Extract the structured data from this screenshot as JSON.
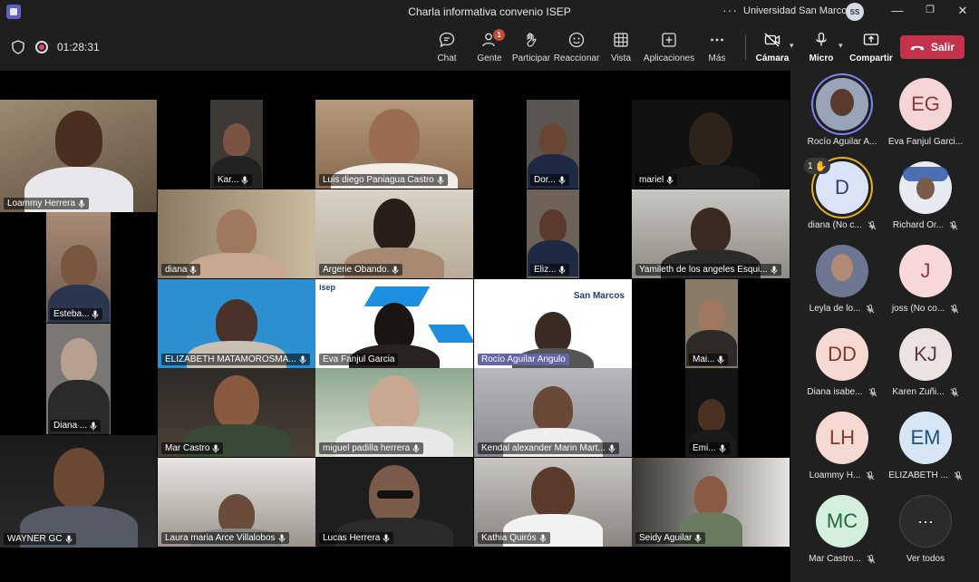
{
  "window": {
    "title": "Charla informativa convenio ISEP",
    "org": "Universidad San Marcos",
    "user_initials": "SS",
    "menu_glyph": "···",
    "min_glyph": "—",
    "max_glyph": "❐",
    "close_glyph": "✕"
  },
  "meeting": {
    "timer": "01:28:31",
    "toolbar": {
      "chat": "Chat",
      "people": "Gente",
      "people_badge": "1",
      "raise": "Participar",
      "react": "Reaccionar",
      "view": "Vista",
      "apps": "Aplicaciones",
      "more": "Más",
      "camera": "Cámara",
      "mic": "Micro",
      "share": "Compartir",
      "leave": "Salir"
    }
  },
  "tiles": [
    {
      "name": "Loammy Herrera"
    },
    {
      "name": "Kar..."
    },
    {
      "name": "Luis diego Paniagua Castro"
    },
    {
      "name": "Dor..."
    },
    {
      "name": "mariel"
    },
    {
      "name": "Esteba..."
    },
    {
      "name": "diana"
    },
    {
      "name": "Argerie  Obando."
    },
    {
      "name": "Eliz..."
    },
    {
      "name": "Yamileth de los angeles Esqui..."
    },
    {
      "name": "ELIZABETH MATAMOROSMA..."
    },
    {
      "name": "Eva Fanjul Garcia",
      "slide_logo": "isep"
    },
    {
      "name": "Rocío Aguilar Angulo",
      "slide_logo": "San Marcos"
    },
    {
      "name": "Mai..."
    },
    {
      "name": "Diana ..."
    },
    {
      "name": "Mar Castro"
    },
    {
      "name": "miguel padilla herrera"
    },
    {
      "name": "Kendal alexander Marin Mart..."
    },
    {
      "name": "Emi..."
    },
    {
      "name": "WAYNER GC"
    },
    {
      "name": "Laura maria Arce Villalobos"
    },
    {
      "name": "Lucas Herrera"
    },
    {
      "name": "Kathia Quirós"
    },
    {
      "name": "Seidy Aguilar"
    }
  ],
  "roster": [
    {
      "name": "Rocío Aguilar A...",
      "initials": "",
      "bg": "#9aa4b8",
      "fg": "#ffffff",
      "ring": "speak"
    },
    {
      "name": "Eva Fanjul Garci...",
      "initials": "EG",
      "bg": "#f5d5d5",
      "fg": "#8f3a3a",
      "ring": ""
    },
    {
      "name": "diana (No c...",
      "initials": "D",
      "bg": "#dbe4f6",
      "fg": "#2a3f73",
      "ring": "hand",
      "hand_count": "1"
    },
    {
      "name": "Richard Or...",
      "initials": "",
      "bg": "#e7eaf0",
      "fg": "#333333",
      "ring": ""
    },
    {
      "name": "Leyla de lo...",
      "initials": "",
      "bg": "#6d7791",
      "fg": "#ffffff",
      "ring": ""
    },
    {
      "name": "joss (No co...",
      "initials": "J",
      "bg": "#f8d8d8",
      "fg": "#8f3a3a",
      "ring": ""
    },
    {
      "name": "Diana isabe...",
      "initials": "DD",
      "bg": "#f6d9d0",
      "fg": "#7e3a2a",
      "ring": ""
    },
    {
      "name": "Karen Zuñi...",
      "initials": "KJ",
      "bg": "#ece2e2",
      "fg": "#5a3a3a",
      "ring": ""
    },
    {
      "name": "Loammy H...",
      "initials": "LH",
      "bg": "#f6d9d0",
      "fg": "#7e3a2a",
      "ring": ""
    },
    {
      "name": "ELIZABETH ...",
      "initials": "EM",
      "bg": "#d6e6f5",
      "fg": "#1f4f7a",
      "ring": ""
    },
    {
      "name": "Mar Castro...",
      "initials": "MC",
      "bg": "#d4efde",
      "fg": "#1f6a3d",
      "ring": ""
    },
    {
      "name": "Ver todos",
      "initials": "···",
      "bg": "#2b2b2b",
      "fg": "#ffffff",
      "ring": "more"
    }
  ]
}
